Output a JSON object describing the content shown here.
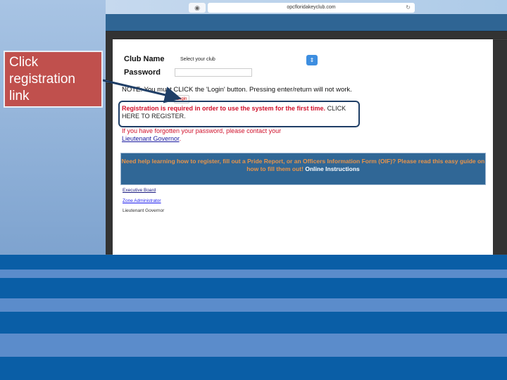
{
  "browser": {
    "url": "opcfloridakeyclub.com"
  },
  "form": {
    "club_label": "Club Name",
    "club_select": "Select your club",
    "password_label": "Password",
    "note": "NOTE: You must CLICK the 'Login' button. Pressing enter/return will not work.",
    "login_button": "Login",
    "registration_text": "Registration is required in order to use the system for the first time.",
    "register_link": "CLICK HERE TO REGISTER.",
    "forgot_text": "If you have forgotten your password, please contact your",
    "forgot_link": "Lieutenant Governor",
    "forgot_end": "."
  },
  "help": {
    "text": "Need help learning how to register, fill out a Pride Report, or an Officers Information Form (OIF)? Please read this easy guide on how to fill them out!",
    "link": "Online Instructions"
  },
  "links": [
    "Executive Board",
    "Zone Administrator",
    "Lieutenant Governor"
  ],
  "callout": {
    "text": "Click registration link",
    "color": "#c0504d"
  }
}
